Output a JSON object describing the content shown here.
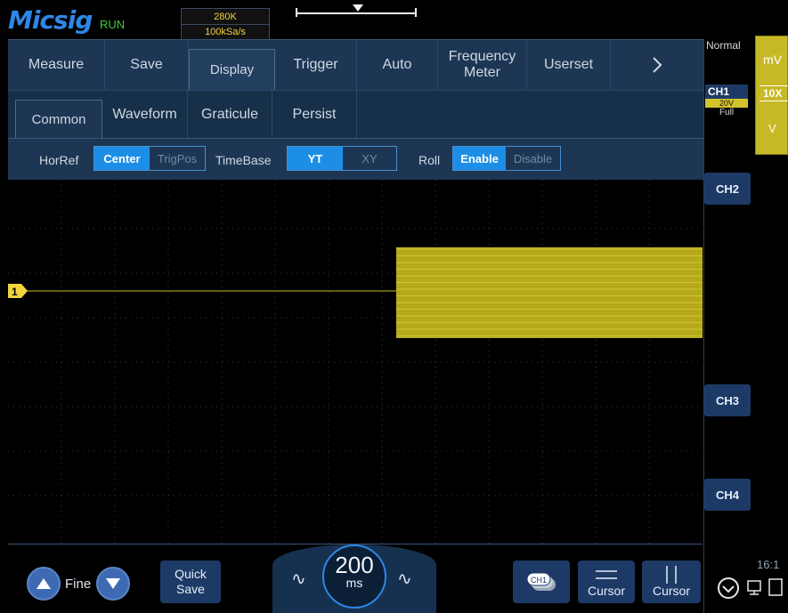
{
  "brand": "Micsig",
  "status": "RUN",
  "acquisition": {
    "memory": "280K",
    "sample_rate": "100kSa/s"
  },
  "menu": {
    "top_tabs": [
      "Measure",
      "Save",
      "Display",
      "Trigger",
      "Auto",
      "Frequency\nMeter",
      "Userset"
    ],
    "active_top_tab": "Display",
    "more_icon": "chevron-right-icon",
    "sub_tabs": [
      "Common",
      "Waveform",
      "Graticule",
      "Persist"
    ],
    "active_sub_tab": "Common",
    "controls": {
      "horref": {
        "label": "HorRef",
        "options": [
          "Center",
          "TrigPos"
        ],
        "selected": "Center"
      },
      "timebase": {
        "label": "TimeBase",
        "options": [
          "YT",
          "XY"
        ],
        "selected": "YT"
      },
      "roll": {
        "label": "Roll",
        "options": [
          "Enable",
          "Disable"
        ],
        "selected": "Enable"
      }
    }
  },
  "scope": {
    "channel_marker": "1",
    "trace_color": "#c9bc1e",
    "grid_color": "#3a3a3a"
  },
  "right_panel": {
    "trigger_mode": "Normal",
    "ch1": {
      "label": "CH1",
      "scale": "20V",
      "bandwidth": "Full"
    },
    "probe": {
      "unit_top": "mV",
      "attenuation": "10X",
      "unit_bottom": "V"
    },
    "channels": [
      "CH2",
      "CH3",
      "CH4"
    ],
    "clock": "16:1"
  },
  "bottom_bar": {
    "fine_label": "Fine",
    "quick_save": "Quick\nSave",
    "timebase": {
      "value": "200",
      "unit": "ms"
    },
    "ch1_chip": "CH1",
    "cursor1": "Cursor",
    "cursor2": "Cursor"
  },
  "colors": {
    "accent": "#1d8ee6",
    "ch1": "#d3c32a",
    "panel": "#1d3653"
  }
}
